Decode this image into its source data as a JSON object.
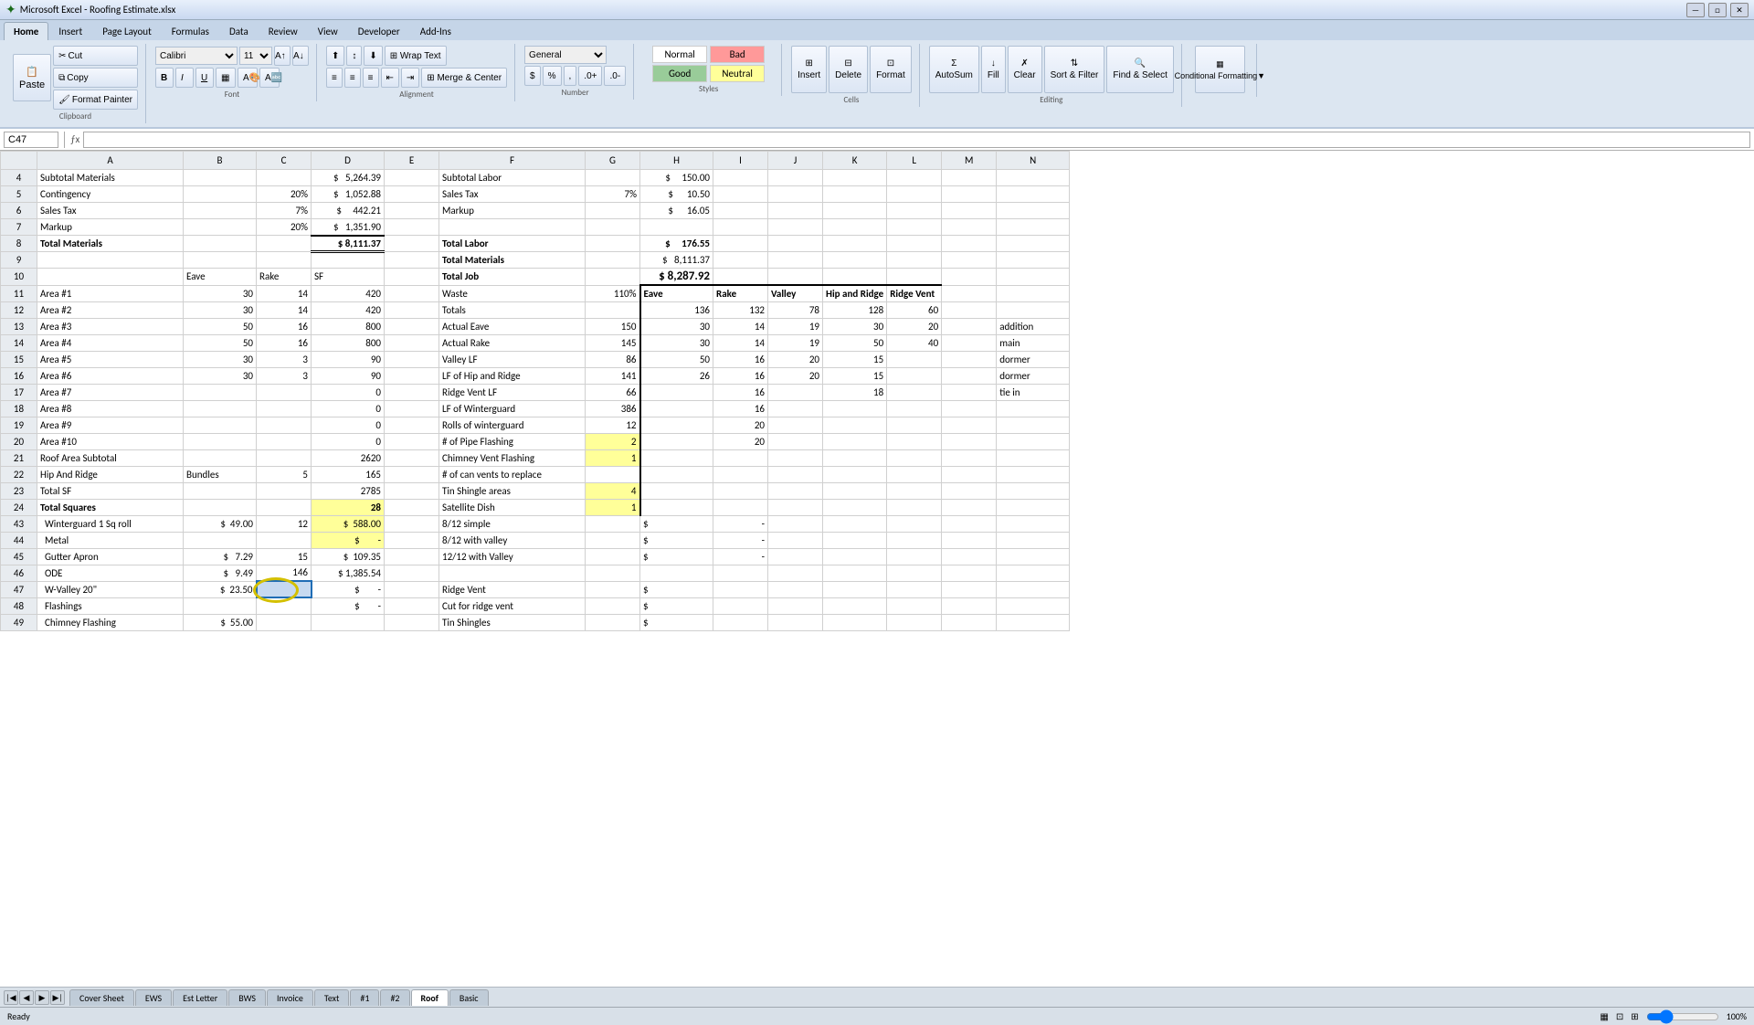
{
  "titleBar": {
    "title": "Microsoft Excel - Roofing Estimate.xlsx",
    "minBtn": "—",
    "maxBtn": "□",
    "closeBtn": "✕"
  },
  "ribbon": {
    "tabs": [
      "Home",
      "Insert",
      "Page Layout",
      "Formulas",
      "Data",
      "Review",
      "View",
      "Developer",
      "Add-Ins"
    ],
    "activeTab": "Home",
    "groups": {
      "clipboard": {
        "label": "Clipboard",
        "buttons": [
          "Paste",
          "Cut",
          "Copy",
          "Format Painter"
        ]
      },
      "font": {
        "label": "Font",
        "fontName": "Calibri",
        "fontSize": "11"
      },
      "alignment": {
        "label": "Alignment"
      },
      "number": {
        "label": "Number",
        "format": "General"
      },
      "styles": {
        "label": "Styles",
        "normal": "Normal",
        "bad": "Bad",
        "good": "Good",
        "neutral": "Neutral"
      },
      "cells": {
        "label": "Cells",
        "insert": "Insert",
        "delete": "Delete",
        "format": "Format"
      },
      "editing": {
        "label": "Editing",
        "autosum": "AutoSum",
        "fill": "Fill",
        "clear": "Clear",
        "sortFilter": "Sort & Filter",
        "findSelect": "Find & Select"
      }
    }
  },
  "formulaBar": {
    "cellRef": "C47",
    "formula": ""
  },
  "columns": [
    "A",
    "B",
    "C",
    "D",
    "E",
    "F",
    "G",
    "H",
    "I",
    "J",
    "K",
    "L",
    "M",
    "N"
  ],
  "rows": {
    "4": {
      "A": "Subtotal Materials",
      "D": "$   5,264.39",
      "F": "Subtotal Labor",
      "H": "$       150.00"
    },
    "5": {
      "A": "Contingency",
      "C": "20%",
      "D": "$   1,052.88",
      "F": "Sales Tax",
      "G": "7%",
      "H": "$         10.50"
    },
    "6": {
      "A": "Sales Tax",
      "C": "7%",
      "D": "$      442.21",
      "F": "Markup",
      "H": "$         16.05"
    },
    "7": {
      "A": "Markup",
      "C": "20%",
      "D": "$   1,351.90"
    },
    "8": {
      "A": "Total Materials",
      "D": "$ 8,111.37",
      "F": "Total Labor",
      "H": "$       176.55"
    },
    "9": {
      "F": "Total Materials",
      "H": "$    8,111.37"
    },
    "10": {
      "B": "Eave",
      "C": "Rake",
      "D": "SF",
      "F": "Total Job",
      "H": "$ 8,287.92"
    },
    "11": {
      "A": "Area #1",
      "B": "30",
      "C": "14",
      "D": "420",
      "F": "Waste",
      "G": "110%",
      "H": "Eave",
      "I": "Rake",
      "J": "Valley",
      "K": "Hip and Ridge",
      "L": "Ridge Vent"
    },
    "12": {
      "A": "Area #2",
      "B": "30",
      "C": "14",
      "D": "420",
      "F": "Totals",
      "H": "136",
      "I": "132",
      "J": "78",
      "K": "128",
      "L": "60"
    },
    "13": {
      "A": "Area #3",
      "B": "50",
      "C": "16",
      "D": "800",
      "F": "Actual Eave",
      "G": "150",
      "H": "30",
      "I": "14",
      "J": "19",
      "K": "30",
      "L": "20",
      "N": "addition"
    },
    "14": {
      "A": "Area #4",
      "B": "50",
      "C": "16",
      "D": "800",
      "F": "Actual Rake",
      "G": "145",
      "H": "30",
      "I": "14",
      "J": "19",
      "K": "50",
      "L": "40",
      "N": "main"
    },
    "15": {
      "A": "Area #5",
      "B": "30",
      "C": "3",
      "D": "90",
      "F": "Valley LF",
      "G": "86",
      "H": "50",
      "I": "16",
      "J": "20",
      "K": "15",
      "N": "dormer"
    },
    "16": {
      "A": "Area #6",
      "B": "30",
      "C": "3",
      "D": "90",
      "F": "LF of Hip and Ridge",
      "G": "141",
      "H": "26",
      "I": "16",
      "J": "20",
      "K": "15",
      "N": "dormer"
    },
    "17": {
      "A": "Area #7",
      "D": "0",
      "F": "Ridge Vent LF",
      "G": "66",
      "I": "16",
      "K": "18",
      "N": "tie in"
    },
    "18": {
      "A": "Area #8",
      "D": "0",
      "F": "LF of Winterguard",
      "G": "386",
      "I": "16"
    },
    "19": {
      "A": "Area #9",
      "D": "0",
      "F": "Rolls of winterguard",
      "G": "12",
      "I": "20"
    },
    "20": {
      "A": "Area #10",
      "D": "0",
      "F": "# of Pipe Flashing",
      "G": "2",
      "I": "20"
    },
    "21": {
      "A": "Roof Area Subtotal",
      "D": "2620",
      "F": "Chimney Vent Flashing",
      "G": "1"
    },
    "22": {
      "A": "Hip And Ridge",
      "B": "Bundles",
      "C": "5",
      "D": "165",
      "F": "# of can vents to replace"
    },
    "23": {
      "A": "Total SF",
      "D": "2785",
      "F": "Tin Shingle areas",
      "G": "4"
    },
    "24": {
      "A": "Total Squares",
      "D": "28",
      "F": "Satellite Dish",
      "G": "1"
    },
    "43": {
      "A": "  Winterguard 1 Sq roll",
      "B": "$      49.00",
      "C": "12",
      "D": "$      588.00",
      "F": "8/12 simple",
      "H": "$",
      "I": "-"
    },
    "44": {
      "A": "  Metal",
      "D": "$           -",
      "F": "8/12 with valley",
      "H": "$",
      "I": "-"
    },
    "45": {
      "A": "  Gutter Apron",
      "B": "$        7.29",
      "C": "15",
      "D": "$      109.35",
      "F": "12/12 with Valley",
      "H": "$",
      "I": "-"
    },
    "46": {
      "A": "  ODE",
      "B": "$        9.49",
      "C": "146",
      "D": "$   1,385.54"
    },
    "47": {
      "A": "  W-Valley 20\"",
      "B": "$      23.50",
      "D": "$           -",
      "F": "Ridge Vent",
      "H": "$"
    },
    "48": {
      "A": "  Flashings",
      "D": "$           -",
      "F": "Cut for ridge vent",
      "H": "$"
    },
    "49": {
      "A": "  Chimney Flashing",
      "B": "$      55.00",
      "F": "Tin Shingles",
      "H": "$"
    }
  },
  "sheetTabs": {
    "tabs": [
      "Cover Sheet",
      "EWS",
      "Est Letter",
      "BWS",
      "Invoice",
      "Text",
      "#1",
      "#2",
      "Roof",
      "Basic"
    ],
    "active": "Roof"
  },
  "statusBar": {
    "left": "Ready",
    "right": "100%"
  }
}
